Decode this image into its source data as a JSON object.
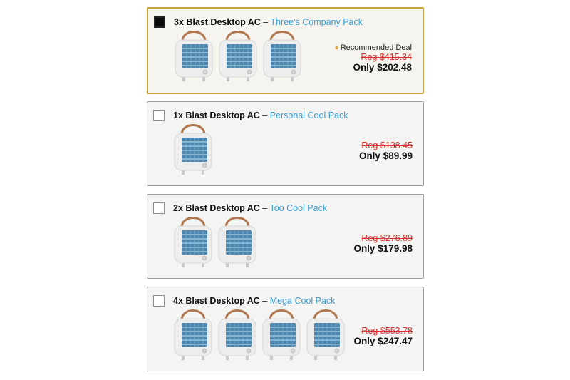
{
  "offers": [
    {
      "qty_label": "3x Blast Desktop AC",
      "separator": "–",
      "pack_name": "Three's Company Pack",
      "badge": "Recommended Deal",
      "regular_price": "Reg $415.34",
      "offer_price": "Only $202.48",
      "unit_count": 3,
      "selected": true
    },
    {
      "qty_label": "1x Blast Desktop AC",
      "separator": "–",
      "pack_name": "Personal Cool Pack",
      "regular_price": "Reg $138.45",
      "offer_price": "Only $89.99",
      "unit_count": 1,
      "selected": false
    },
    {
      "qty_label": "2x Blast Desktop AC",
      "separator": "–",
      "pack_name": "Too Cool Pack",
      "regular_price": "Reg $276.89",
      "offer_price": "Only $179.98",
      "unit_count": 2,
      "selected": false
    },
    {
      "qty_label": "4x Blast Desktop AC",
      "separator": "–",
      "pack_name": "Mega Cool Pack",
      "regular_price": "Reg $553.78",
      "offer_price": "Only $247.47",
      "unit_count": 4,
      "selected": false
    }
  ],
  "colors": {
    "accent_border": "#c9a23d",
    "pack_link": "#3a9fd8",
    "regular_price": "#d9322e",
    "badge_dot": "#e7a33a"
  }
}
